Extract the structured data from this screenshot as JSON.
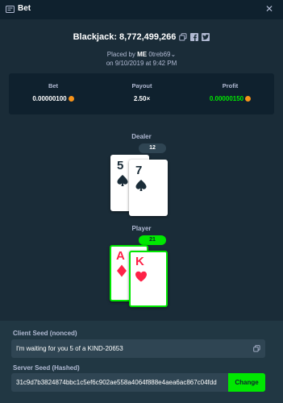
{
  "header": {
    "title": "Bet",
    "icon": "bet-ticket-icon",
    "close_icon": "close-icon"
  },
  "game": {
    "title": "Blackjack: 8,772,499,266",
    "placed_by_prefix": "Placed by",
    "player_name": "ME",
    "user_handle": "0treb69",
    "placed_on": "on 9/10/2019 at 9:42 PM"
  },
  "stats": [
    {
      "label": "Bet",
      "value": "0.00000100",
      "value_color": "#ffffff",
      "currency_icon": "bitcoin-icon"
    },
    {
      "label": "Payout",
      "value": "2.50×",
      "value_color": "#ffffff"
    },
    {
      "label": "Profit",
      "value": "0.00000150",
      "value_color": "#00e701",
      "currency_icon": "bitcoin-icon"
    }
  ],
  "dealer": {
    "label": "Dealer",
    "total": "12",
    "cards": [
      {
        "rank": "5",
        "suit": "spades",
        "color": "black"
      },
      {
        "rank": "7",
        "suit": "spades",
        "color": "black"
      }
    ]
  },
  "player": {
    "label": "Player",
    "total": "21",
    "cards": [
      {
        "rank": "A",
        "suit": "diamonds",
        "color": "red"
      },
      {
        "rank": "K",
        "suit": "hearts",
        "color": "red"
      }
    ]
  },
  "seeds": {
    "client_label": "Client Seed (nonced)",
    "client_value": "I'm waiting for you 5 of a KIND-20653",
    "server_label": "Server Seed (Hashed)",
    "server_value": "31c9d7b3824874bbc1c5ef6c902ae558a4064f888e4aea6ac867c04fdd",
    "change_label": "Change"
  },
  "colors": {
    "background": "#1a2c38",
    "header": "#0f212e",
    "accent_green": "#00e701",
    "card_red": "#fe2247"
  }
}
